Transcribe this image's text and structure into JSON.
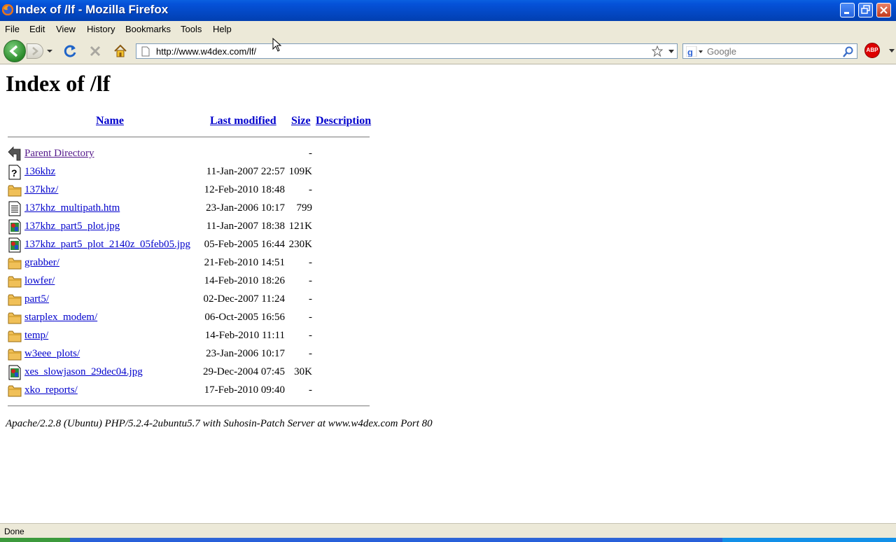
{
  "window": {
    "title": "Index of /lf - Mozilla Firefox"
  },
  "menu": [
    "File",
    "Edit",
    "View",
    "History",
    "Bookmarks",
    "Tools",
    "Help"
  ],
  "nav": {
    "url": "http://www.w4dex.com/lf/",
    "search_placeholder": "Google",
    "adblock_label": "ABP"
  },
  "page": {
    "heading": "Index of /lf",
    "columns": {
      "name": "Name",
      "modified": "Last modified",
      "size": "Size",
      "description": "Description"
    },
    "parent": {
      "name": "Parent Directory",
      "size": "-"
    },
    "rows": [
      {
        "icon": "unknown-file-icon",
        "name": "136khz",
        "date": "11-Jan-2007 22:57",
        "size": "109K"
      },
      {
        "icon": "folder-icon",
        "name": "137khz/",
        "date": "12-Feb-2010 18:48",
        "size": "-"
      },
      {
        "icon": "text-file-icon",
        "name": "137khz_multipath.htm",
        "date": "23-Jan-2006 10:17",
        "size": "799"
      },
      {
        "icon": "image-file-icon",
        "name": "137khz_part5_plot.jpg",
        "date": "11-Jan-2007 18:38",
        "size": "121K"
      },
      {
        "icon": "image-file-icon",
        "name": "137khz_part5_plot_2140z_05feb05.jpg",
        "date": "05-Feb-2005 16:44",
        "size": "230K"
      },
      {
        "icon": "folder-icon",
        "name": "grabber/",
        "date": "21-Feb-2010 14:51",
        "size": "-"
      },
      {
        "icon": "folder-icon",
        "name": "lowfer/",
        "date": "14-Feb-2010 18:26",
        "size": "-"
      },
      {
        "icon": "folder-icon",
        "name": "part5/",
        "date": "02-Dec-2007 11:24",
        "size": "-"
      },
      {
        "icon": "folder-icon",
        "name": "starplex_modem/",
        "date": "06-Oct-2005 16:56",
        "size": "-"
      },
      {
        "icon": "folder-icon",
        "name": "temp/",
        "date": "14-Feb-2010 11:11",
        "size": "-"
      },
      {
        "icon": "folder-icon",
        "name": "w3eee_plots/",
        "date": "23-Jan-2006 10:17",
        "size": "-"
      },
      {
        "icon": "image-file-icon",
        "name": "xes_slowjason_29dec04.jpg",
        "date": "29-Dec-2004 07:45",
        "size": "30K"
      },
      {
        "icon": "folder-icon",
        "name": "xko_reports/",
        "date": "17-Feb-2010 09:40",
        "size": "-"
      }
    ],
    "footer": "Apache/2.2.8 (Ubuntu) PHP/5.2.4-2ubuntu5.7 with Suhosin-Patch Server at www.w4dex.com Port 80"
  },
  "status": {
    "text": "Done"
  }
}
